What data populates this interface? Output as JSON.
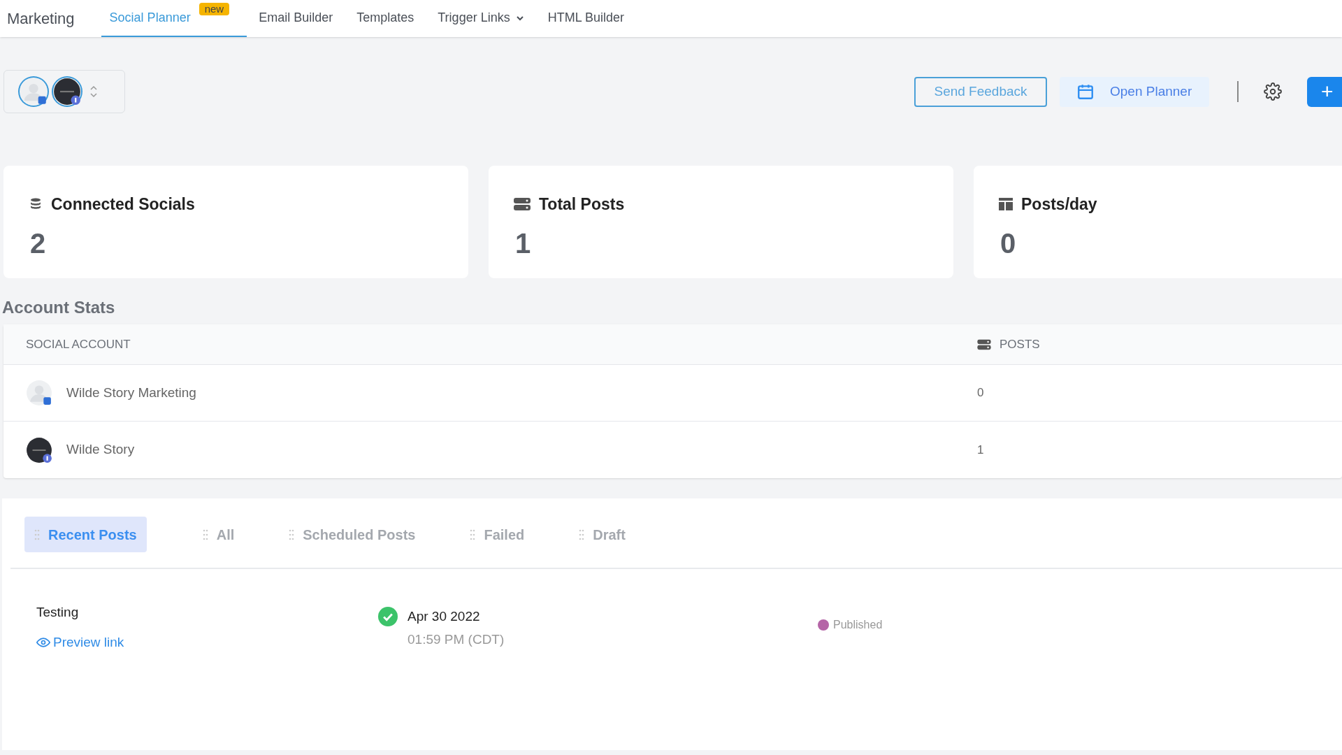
{
  "nav": {
    "title": "Marketing",
    "tabs": [
      {
        "label": "Social Planner",
        "selected": true,
        "badge": "new",
        "dropdown": false
      },
      {
        "label": "Email Builder",
        "selected": false,
        "dropdown": false
      },
      {
        "label": "Templates",
        "selected": false,
        "dropdown": false
      },
      {
        "label": "Trigger Links",
        "selected": false,
        "dropdown": true
      },
      {
        "label": "HTML Builder",
        "selected": false,
        "dropdown": false
      }
    ]
  },
  "toolbar": {
    "accounts": [
      {
        "kind": "blank"
      },
      {
        "kind": "dark"
      }
    ],
    "buttons": [
      "Send Feedback",
      "Open Planner",
      "+"
    ]
  },
  "stats": [
    {
      "kind": "stack",
      "label": "Connected Socials",
      "value": "2"
    },
    {
      "kind": "server",
      "label": "Total Posts",
      "value": "1"
    },
    {
      "kind": "layout",
      "label": "Posts/day",
      "value": "0"
    }
  ],
  "account_stats": {
    "title": "Account Stats",
    "columns": [
      "SOCIAL ACCOUNT",
      "POSTS"
    ],
    "rows": [
      {
        "kind": "blank",
        "name": "Wilde Story Marketing",
        "posts": "0"
      },
      {
        "kind": "dark",
        "name": "Wilde Story",
        "posts": "1"
      }
    ]
  },
  "post_tabs": [
    {
      "label": "Recent Posts",
      "selected": true
    },
    {
      "label": "All",
      "selected": false
    },
    {
      "label": "Scheduled Posts",
      "selected": false
    },
    {
      "label": "Failed",
      "selected": false
    },
    {
      "label": "Draft",
      "selected": false
    }
  ],
  "posts": [
    {
      "title": "Testing",
      "link": "Preview link",
      "date": "Apr 30 2022",
      "time": "01:59 PM (CDT)",
      "status": "Published",
      "color": "#b565a7"
    }
  ]
}
